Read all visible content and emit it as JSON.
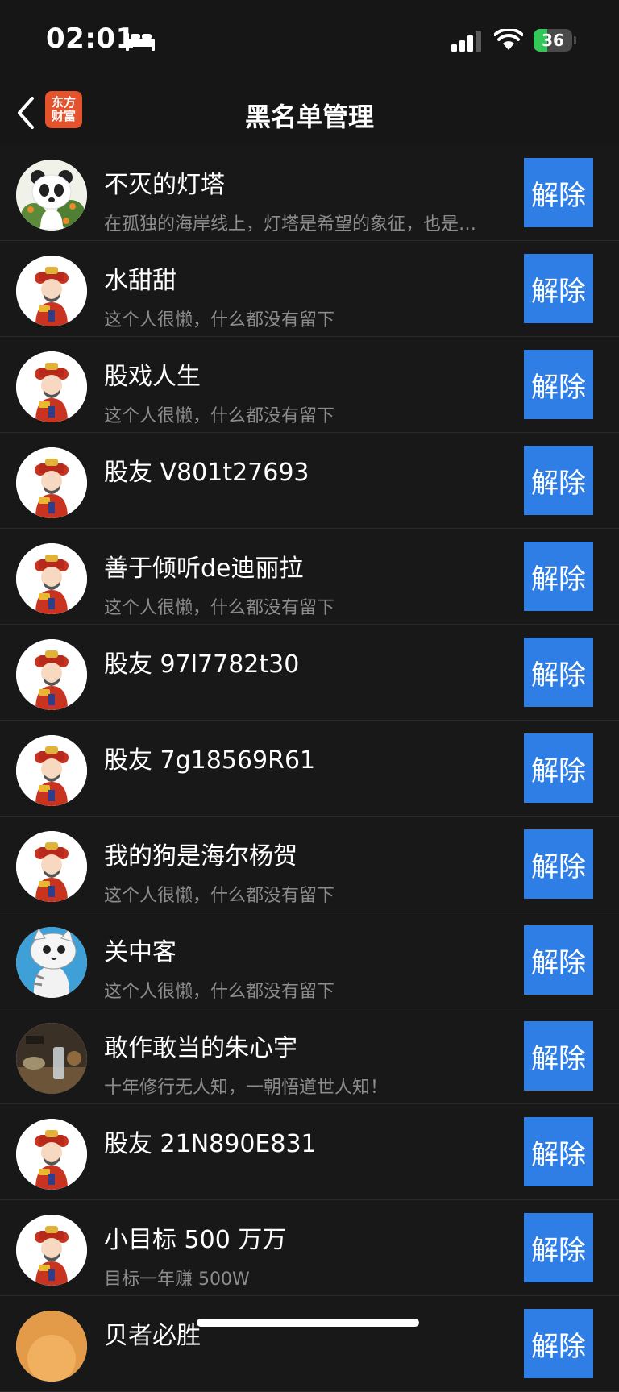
{
  "status_bar": {
    "time": "02:01",
    "battery_level": "36",
    "icons": [
      "bed-icon",
      "signal-icon",
      "wifi-icon",
      "battery-icon"
    ]
  },
  "nav": {
    "title": "黑名单管理",
    "logo_line1": "东方",
    "logo_line2": "财富",
    "back_icon": "chevron-left-icon"
  },
  "colors": {
    "background": "#181818",
    "accent_button": "#2f7ee6",
    "logo": "#e4532c",
    "secondary_text": "#8c8c8c"
  },
  "unblock_label": "解除",
  "blocked_users": [
    {
      "name": "不灭的灯塔",
      "signature": "在孤独的海岸线上，灯塔是希望的象征，也是…",
      "avatar": "panda-avatar"
    },
    {
      "name": "水甜甜",
      "signature": "这个人很懒，什么都没有留下",
      "avatar": "fortune-god-avatar"
    },
    {
      "name": "股戏人生",
      "signature": "这个人很懒，什么都没有留下",
      "avatar": "fortune-god-avatar"
    },
    {
      "name": "股友 V801t27693",
      "signature": "",
      "avatar": "fortune-god-avatar"
    },
    {
      "name": "善于倾听de迪丽拉",
      "signature": "这个人很懒，什么都没有留下",
      "avatar": "fortune-god-avatar"
    },
    {
      "name": "股友 97l7782t30",
      "signature": "",
      "avatar": "fortune-god-avatar"
    },
    {
      "name": "股友 7g18569R61",
      "signature": "",
      "avatar": "fortune-god-avatar"
    },
    {
      "name": "我的狗是海尔杨贺",
      "signature": "这个人很懒，什么都没有留下",
      "avatar": "fortune-god-avatar"
    },
    {
      "name": "关中客",
      "signature": "这个人很懒，什么都没有留下",
      "avatar": "cartoon-cat-avatar"
    },
    {
      "name": "敢作敢当的朱心宇",
      "signature": "十年修行无人知，一朝悟道世人知！",
      "avatar": "photo-avatar"
    },
    {
      "name": "股友 21N890E831",
      "signature": "",
      "avatar": "fortune-god-avatar"
    },
    {
      "name": "小目标 500 万万",
      "signature": "目标一年赚 500W",
      "avatar": "fortune-god-avatar"
    },
    {
      "name": "贝者必胜",
      "signature": "",
      "avatar": "orange-avatar"
    }
  ]
}
